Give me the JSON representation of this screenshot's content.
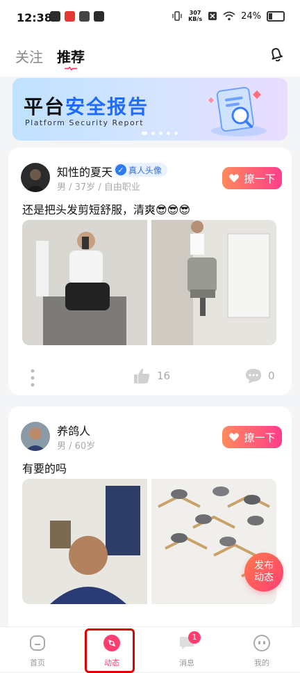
{
  "status_bar": {
    "time": "12:38",
    "net_speed": "307",
    "net_unit": "KB/s",
    "battery": "24%"
  },
  "top_nav": {
    "tab_follow": "关注",
    "tab_recommend": "推荐",
    "bell_icon": "bell-icon"
  },
  "banner": {
    "title_part1": "平台",
    "title_part2": "安全报告",
    "subtitle": "Platform Security Report"
  },
  "posts": [
    {
      "username": "知性的夏天",
      "badge": "真人头像",
      "meta": "男 / 37岁 / 自由职业",
      "action_label": "撩一下",
      "text": "还是把头发剪短舒服，清爽😎😎😎",
      "likes": "16",
      "comments": "0"
    },
    {
      "username": "养鸽人",
      "meta": "男 / 60岁",
      "action_label": "撩一下",
      "text": "有要的吗"
    }
  ],
  "publish_button": {
    "line1": "发布",
    "line2": "动态"
  },
  "bottom_nav": {
    "home": "首页",
    "moments": "动态",
    "messages": "消息",
    "messages_badge": "1",
    "me": "我的"
  },
  "colors": {
    "accent": "#ff3d6e",
    "verified": "#2f7bf5"
  }
}
